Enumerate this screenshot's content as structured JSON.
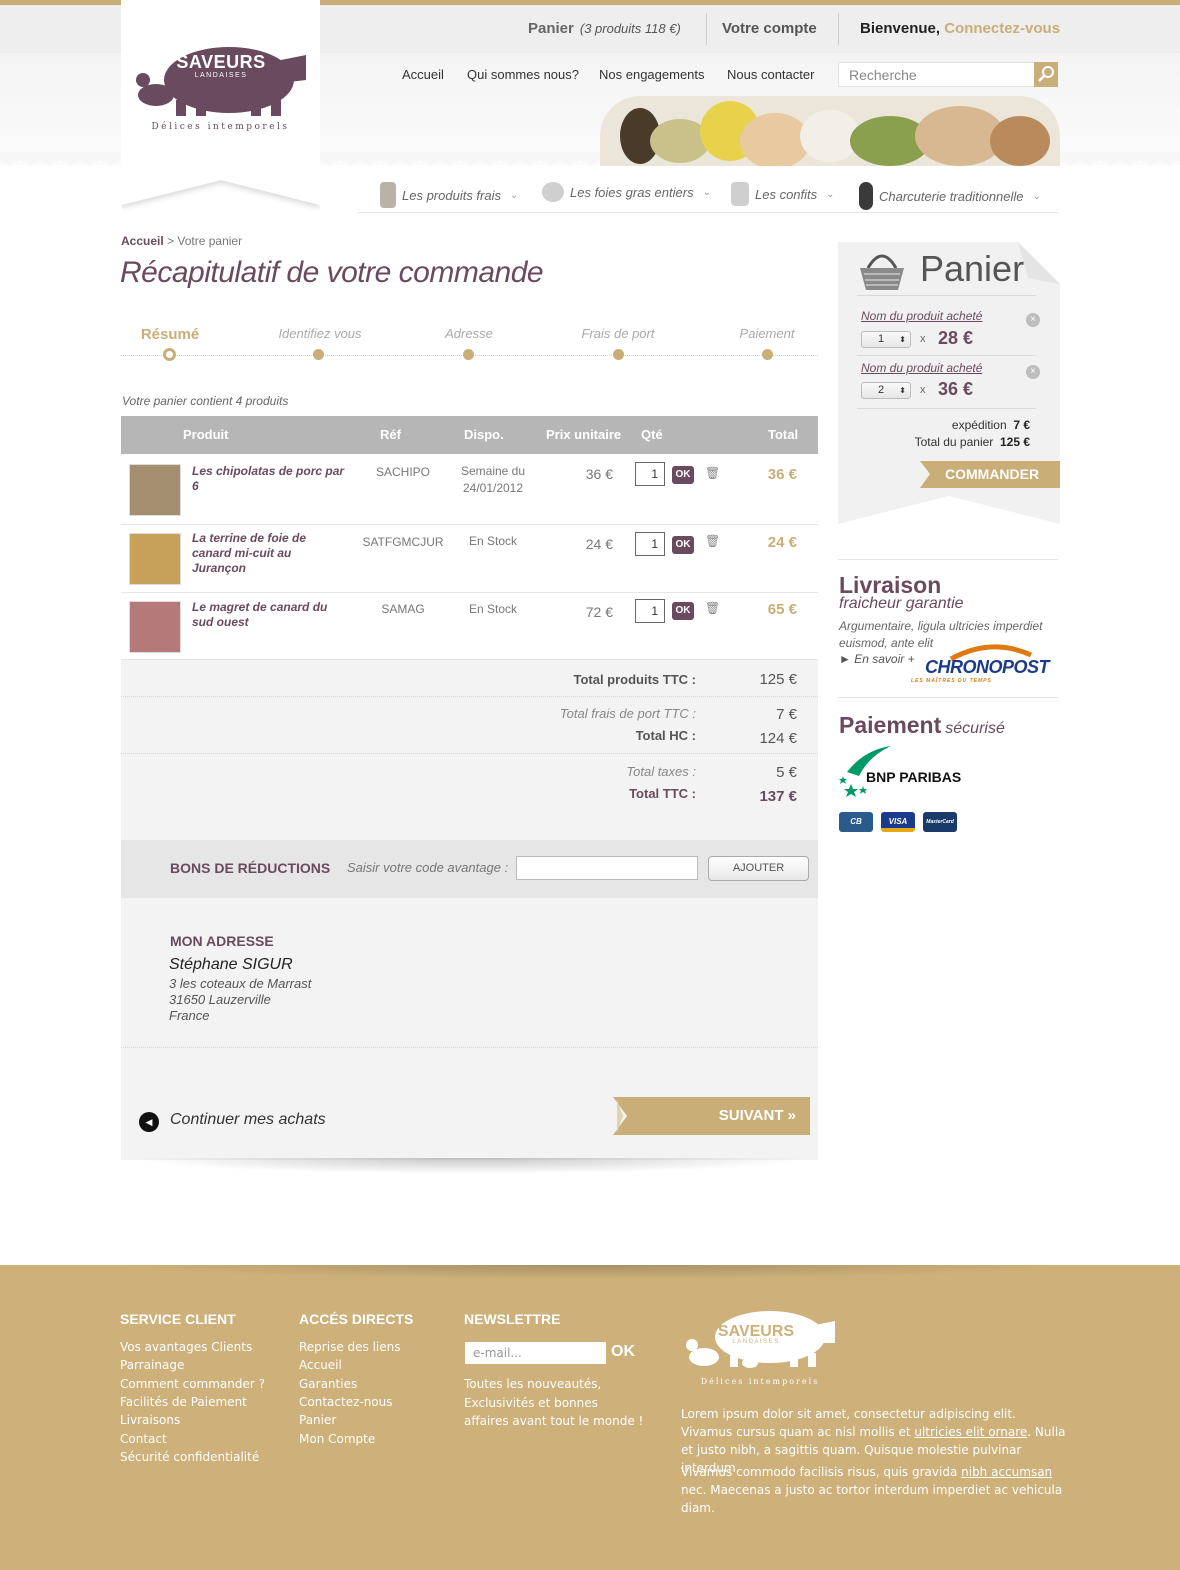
{
  "brand": {
    "name": "SAVEURS",
    "sub": "LANDAISES",
    "tagline": "Délices intemporels"
  },
  "topbar": {
    "cart_label": "Panier",
    "cart_summary": "(3 produits 118 €)",
    "account": "Votre compte",
    "welcome": "Bienvenue,",
    "connect": "Connectez-vous"
  },
  "nav": [
    "Accueil",
    "Qui sommes nous?",
    "Nos engagements",
    "Nous contacter"
  ],
  "search": {
    "placeholder": "Recherche"
  },
  "categories": [
    "Les produits frais",
    "Les foies gras entiers",
    "Les confits",
    "Charcuterie traditionnelle"
  ],
  "breadcrumb": {
    "home": "Accueil",
    "current": "> Votre panier"
  },
  "title": "Récapitulatif de votre commande",
  "steps": [
    "Résumé",
    "Identifiez vous",
    "Adresse",
    "Frais de port",
    "Paiement"
  ],
  "cart": {
    "count_text": "Votre panier contient 4 produits",
    "headers": {
      "produit": "Produit",
      "ref": "Réf",
      "dispo": "Dispo.",
      "unit": "Prix unitaire",
      "qty": "Qté",
      "total": "Total"
    },
    "rows": [
      {
        "name": "Les chipolatas de porc par 6",
        "ref": "SACHIPO",
        "dispo": "Semaine du 24/01/2012",
        "unit": "36 €",
        "qty": "1",
        "ok": "OK",
        "total": "36 €"
      },
      {
        "name": "La terrine de foie de canard mi-cuit au Jurançon",
        "ref": "SATFGMCJUR",
        "dispo": "En Stock",
        "unit": "24 €",
        "qty": "1",
        "ok": "OK",
        "total": "24 €"
      },
      {
        "name": "Le magret de canard du sud ouest",
        "ref": "SAMAG",
        "dispo": "En Stock",
        "unit": "72 €",
        "qty": "1",
        "ok": "OK",
        "total": "65 €"
      }
    ]
  },
  "totals": {
    "produits_label": "Total produits TTC :",
    "produits": "125 €",
    "port_label": "Total frais de port TTC :",
    "port": "7 €",
    "hc_label": "Total HC :",
    "hc": "124 €",
    "taxes_label": "Total taxes :",
    "taxes": "5 €",
    "ttc_label": "Total TTC :",
    "ttc": "137 €"
  },
  "reductions": {
    "title": "BONS DE RÉDUCTIONS",
    "label": "Saisir votre code avantage :",
    "button": "AJOUTER"
  },
  "address": {
    "title": "MON ADRESSE",
    "name": "Stéphane SIGUR",
    "line1": "3 les coteaux de Marrast",
    "line2": "31650 Lauzerville",
    "country": "France"
  },
  "actions": {
    "continue": "Continuer mes achats",
    "next": "SUIVANT  »"
  },
  "sidebar_cart": {
    "title": "Panier",
    "items": [
      {
        "name": "Nom du produit acheté",
        "qty": "1",
        "x": "x",
        "price": "28 €"
      },
      {
        "name": "Nom du produit acheté",
        "qty": "2",
        "x": "x",
        "price": "36 €"
      }
    ],
    "shipping_label": "expédition",
    "shipping": "7 €",
    "total_label": "Total du panier",
    "total": "125 €",
    "order_button": "COMMANDER"
  },
  "livraison": {
    "title": "Livraison",
    "subtitle": "fraicheur garantie",
    "desc": "Argumentaire, ligula ultricies imperdiet euismod, ante elit",
    "more": "► En savoir +",
    "partner": "CHRONOPOST",
    "partner_sub": "LES MAÎTRES DU TEMPS"
  },
  "paiement": {
    "title": "Paiement",
    "subtitle": "sécurisé",
    "bank": "BNP PARIBAS",
    "cards": [
      "CB",
      "VISA",
      "MasterCard"
    ]
  },
  "footer": {
    "service": {
      "title": "SERVICE CLIENT",
      "links": [
        "Vos avantages Clients",
        "Parrainage",
        "Comment commander ?",
        "Facilités de Paiement",
        "Livraisons",
        "Contact",
        "Sécurité confidentialité"
      ]
    },
    "acces": {
      "title": "ACCÉS DIRECTS",
      "links": [
        "Reprise des liens",
        "Accueil",
        "Garanties",
        "Contactez-nous",
        "Panier",
        "Mon Compte"
      ]
    },
    "newsletter": {
      "title": "NEWSLETTRE",
      "placeholder": "e-mail...",
      "ok": "OK",
      "text": "Toutes les nouveautés, Exclusivités et bonnes affaires avant tout le monde !"
    },
    "para1_a": "Lorem ipsum dolor sit amet, consectetur adipiscing elit. Vivamus cursus quam ac nisl mollis et ",
    "para1_link": "ultricies elit ornare",
    "para1_b": ". Nulla et justo nibh, a sagittis quam. Quisque molestie pulvinar interdum.",
    "para2_a": "Vivamus commodo facilisis risus, quis gravida ",
    "para2_link": "nibh accumsan",
    "para2_b": " nec. Maecenas a justo ac tortor interdum imperdiet ac vehicula diam."
  },
  "colors": {
    "accent": "#c9ae78",
    "brand": "#6a4a5e",
    "footer": "#cdb07a"
  }
}
